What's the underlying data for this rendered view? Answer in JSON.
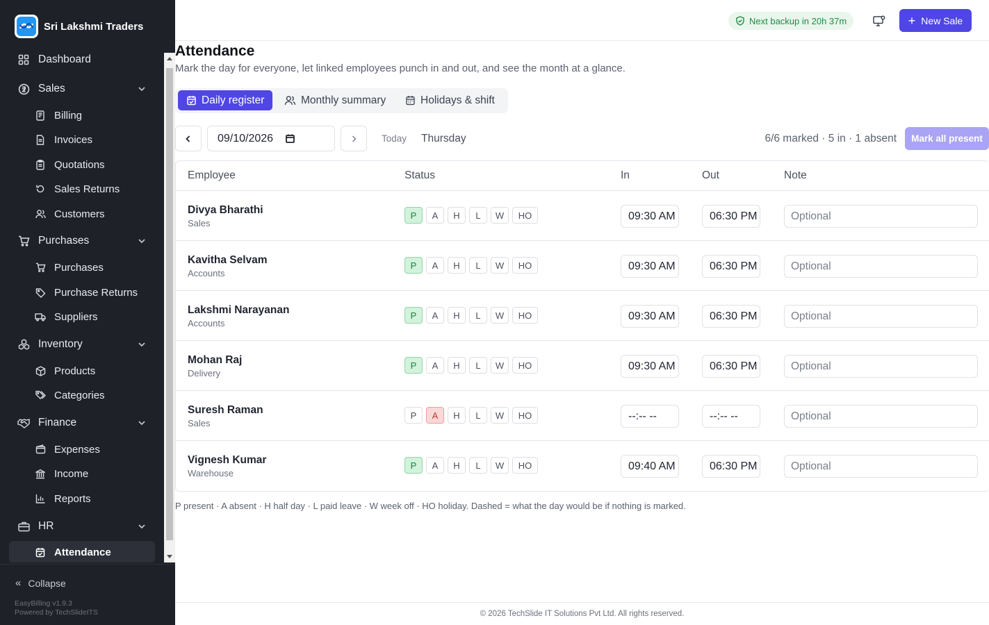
{
  "brand": {
    "name": "Sri Lakshmi Traders"
  },
  "sidebar": {
    "items": [
      {
        "label": "Dashboard",
        "icon": "dashboard-icon"
      },
      {
        "label": "Sales",
        "icon": "sales-icon"
      },
      {
        "label": "Billing",
        "icon": "billing-icon"
      },
      {
        "label": "Invoices",
        "icon": "invoice-icon"
      },
      {
        "label": "Quotations",
        "icon": "quotation-icon"
      },
      {
        "label": "Sales Returns",
        "icon": "return-icon"
      },
      {
        "label": "Customers",
        "icon": "customers-icon"
      },
      {
        "label": "Purchases",
        "icon": "cart-icon"
      },
      {
        "label": "Purchases",
        "icon": "cart-icon"
      },
      {
        "label": "Purchase Returns",
        "icon": "tag-icon"
      },
      {
        "label": "Suppliers",
        "icon": "truck-icon"
      },
      {
        "label": "Inventory",
        "icon": "boxes-icon"
      },
      {
        "label": "Products",
        "icon": "package-icon"
      },
      {
        "label": "Categories",
        "icon": "tags-icon"
      },
      {
        "label": "Finance",
        "icon": "handshake-icon"
      },
      {
        "label": "Expenses",
        "icon": "wallet-icon"
      },
      {
        "label": "Income",
        "icon": "bank-icon"
      },
      {
        "label": "Reports",
        "icon": "bar-chart-icon"
      },
      {
        "label": "HR",
        "icon": "briefcase-icon"
      },
      {
        "label": "Attendance",
        "icon": "calendar-check-icon"
      }
    ],
    "collapse_label": "Collapse",
    "version": "EasyBilling v1.9.3",
    "powered_by": "Powered by TechSlideITS"
  },
  "topbar": {
    "backup_text": "Next backup in 20h 37m",
    "new_sale_label": "New Sale"
  },
  "page": {
    "title": "Attendance",
    "subtitle": "Mark the day for everyone, let linked employees punch in and out, and see the month at a glance."
  },
  "tabs": [
    {
      "label": "Daily register",
      "active": true
    },
    {
      "label": "Monthly summary",
      "active": false
    },
    {
      "label": "Holidays & shift",
      "active": false
    }
  ],
  "toolbar": {
    "date_value": "09/10/2026",
    "today_label": "Today",
    "weekday": "Thursday",
    "summary": "6/6 marked · 5 in · 1 absent",
    "mark_all_label": "Mark all present"
  },
  "table": {
    "headers": {
      "employee": "Employee",
      "status": "Status",
      "in": "In",
      "out": "Out",
      "note": "Note"
    },
    "status_options": [
      "P",
      "A",
      "H",
      "L",
      "W",
      "HO"
    ],
    "note_placeholder": "Optional",
    "rows": [
      {
        "name": "Divya Bharathi",
        "dept": "Sales",
        "status": "P",
        "in": "09:30 AM",
        "out": "06:30 PM"
      },
      {
        "name": "Kavitha Selvam",
        "dept": "Accounts",
        "status": "P",
        "in": "09:30 AM",
        "out": "06:30 PM"
      },
      {
        "name": "Lakshmi Narayanan",
        "dept": "Accounts",
        "status": "P",
        "in": "09:30 AM",
        "out": "06:30 PM"
      },
      {
        "name": "Mohan Raj",
        "dept": "Delivery",
        "status": "P",
        "in": "09:30 AM",
        "out": "06:30 PM"
      },
      {
        "name": "Suresh Raman",
        "dept": "Sales",
        "status": "A",
        "in": "--:-- --",
        "out": "--:-- --"
      },
      {
        "name": "Vignesh Kumar",
        "dept": "Warehouse",
        "status": "P",
        "in": "09:40 AM",
        "out": "06:30 PM"
      }
    ]
  },
  "legend": "P present · A absent · H half day · L paid leave · W week off · HO holiday. Dashed = what the day would be if nothing is marked.",
  "footer": "© 2026 TechSlide IT Solutions Pvt Ltd. All rights reserved.",
  "colors": {
    "accent": "#4f46e5",
    "sidebar_bg": "#1f2129",
    "present": "#1e7f40",
    "absent": "#c0392b"
  }
}
